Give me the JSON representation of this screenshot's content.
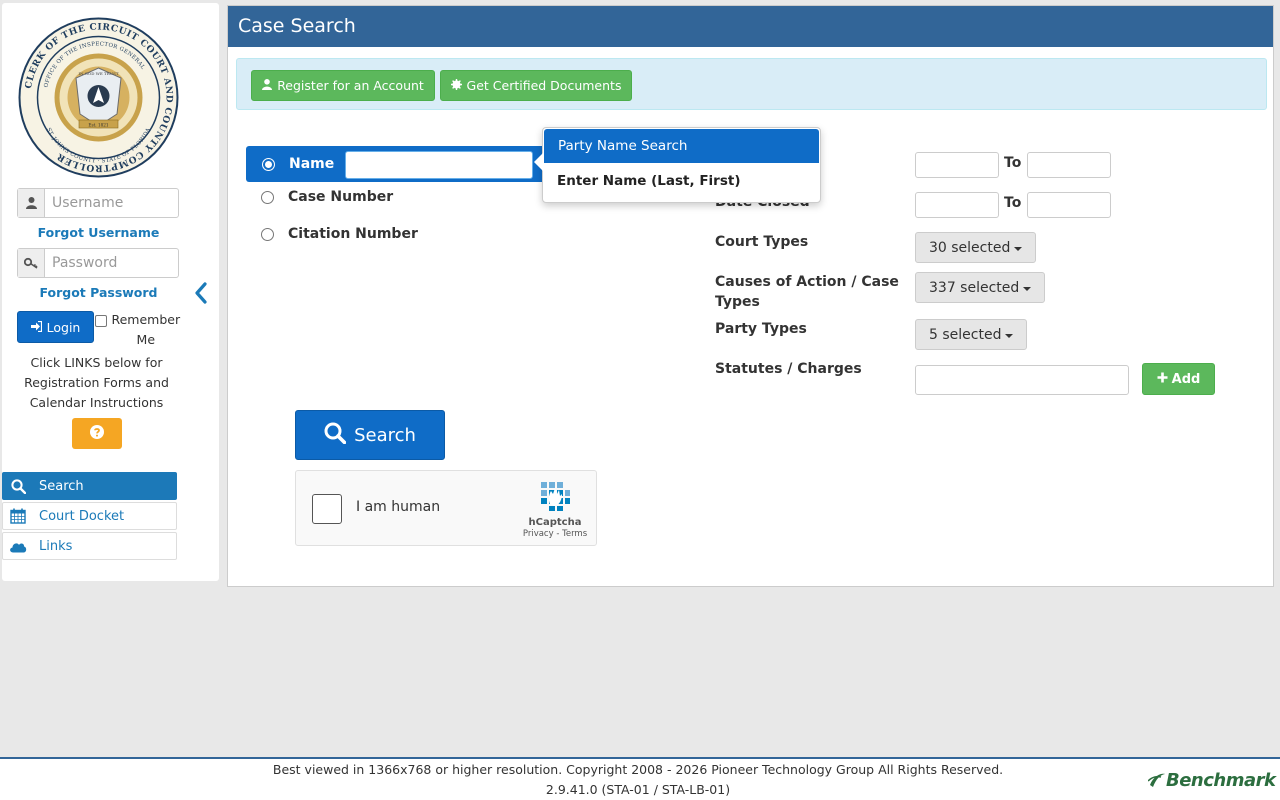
{
  "sidebar": {
    "seal_text": {
      "outer": "CLERK OF THE CIRCUIT COURT AND COUNTY COMPTROLLER",
      "inner": "OFFICE OF THE INSPECTOR GENERAL",
      "bottom": "ST. JOHNS COUNTY · STATE OF FLORIDA",
      "motto": "IN GOD WE TRUST",
      "established": "Est. 1821"
    },
    "username_placeholder": "Username",
    "forgot_username": "Forgot Username",
    "password_placeholder": "Password",
    "forgot_password": "Forgot Password",
    "login_label": "Login",
    "remember_label": "Remember Me",
    "links_note": "Click LINKS below for Registration Forms and Calendar Instructions",
    "help_icon": "question-circle-icon",
    "nav": [
      {
        "label": "Search",
        "icon": "search-icon",
        "active": true
      },
      {
        "label": "Court Docket",
        "icon": "calendar-icon",
        "active": false
      },
      {
        "label": "Links",
        "icon": "cloud-icon",
        "active": false
      }
    ]
  },
  "main": {
    "title": "Case Search",
    "register_label": "Register for an Account",
    "certified_label": "Get Certified Documents",
    "search_options": [
      {
        "label": "Name",
        "selected": true
      },
      {
        "label": "Case Number",
        "selected": false
      },
      {
        "label": "Citation Number",
        "selected": false
      }
    ],
    "name_value": "",
    "popover": {
      "title": "Party Name Search",
      "body": "Enter Name (Last, First)"
    },
    "filters": {
      "date_filed_to": "To",
      "date_closed_label": "Date Closed",
      "date_closed_to": "To",
      "court_types_label": "Court Types",
      "court_types_value": "30 selected",
      "causes_label": "Causes of Action / Case Types",
      "causes_value": "337 selected",
      "party_types_label": "Party Types",
      "party_types_value": "5 selected",
      "statutes_label": "Statutes / Charges",
      "add_label": "Add"
    },
    "search_label": "Search",
    "captcha": {
      "label": "I am human",
      "brand": "hCaptcha",
      "links": "Privacy - Terms"
    }
  },
  "footer": {
    "line1": "Best viewed in 1366x768 or higher resolution. Copyright 2008 - 2026 Pioneer Technology Group All Rights Reserved.",
    "line2": "2.9.41.0 (STA-01 / STA-LB-01)",
    "logo_text": "Benchmark"
  },
  "colors": {
    "header_blue": "#326598",
    "primary_blue": "#0f6cc7",
    "green": "#5cb85c",
    "alert_bg": "#d9edf7",
    "help_orange": "#f5a623"
  }
}
